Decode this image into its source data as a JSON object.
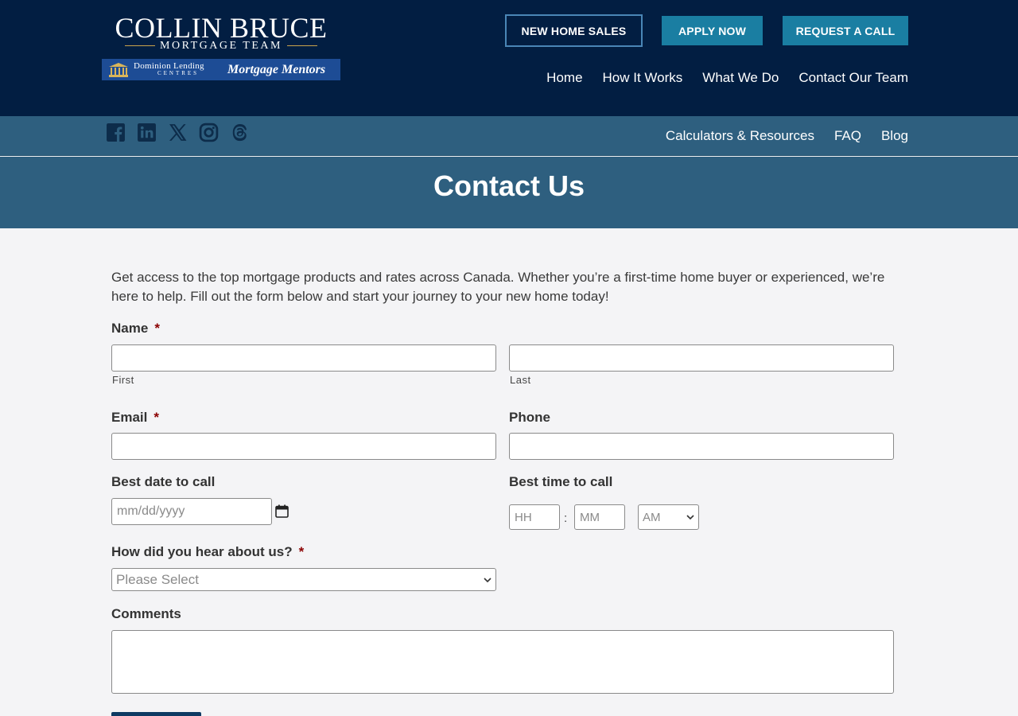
{
  "header": {
    "logo": {
      "name": "COLLIN BRUCE",
      "team": "MORTGAGE TEAM",
      "dlc_line1": "Dominion Lending",
      "dlc_line2": "CENTRES",
      "mentors": "Mortgage Mentors"
    },
    "buttons": {
      "new_home_sales": "NEW HOME SALES",
      "apply_now": "APPLY NOW",
      "request_call": "REQUEST A CALL"
    },
    "nav": [
      {
        "label": "Home"
      },
      {
        "label": "How It Works"
      },
      {
        "label": "What We Do"
      },
      {
        "label": "Contact Our Team"
      }
    ]
  },
  "sub_bar": {
    "social_icons": [
      "facebook-icon",
      "linkedin-icon",
      "x-icon",
      "instagram-icon",
      "threads-icon"
    ],
    "nav": [
      {
        "label": "Calculators & Resources"
      },
      {
        "label": "FAQ"
      },
      {
        "label": "Blog"
      }
    ]
  },
  "hero": {
    "title": "Contact Us"
  },
  "form": {
    "intro": "Get access to the top mortgage products and rates across Canada. Whether you’re a first-time home buyer or experienced, we’re here to help. Fill out the form below and start your journey to your new home today!",
    "required_mark": "*",
    "name_label": "Name",
    "first_label": "First",
    "last_label": "Last",
    "email_label": "Email",
    "phone_label": "Phone",
    "date_label": "Best date to call",
    "date_placeholder": "mm/dd/yyyy",
    "time_label": "Best time to call",
    "hour_placeholder": "HH",
    "minute_placeholder": "MM",
    "ampm_value": "AM",
    "time_separator": ":",
    "source_label": "How did you hear about us?",
    "source_value": "Please Select",
    "comments_label": "Comments"
  },
  "colors": {
    "header_bg": "#021e42",
    "bar_bg": "#2e5f7f",
    "button_bg": "#1a7ea2",
    "page_bg": "#f4f4f6",
    "required": "#8b0000"
  }
}
